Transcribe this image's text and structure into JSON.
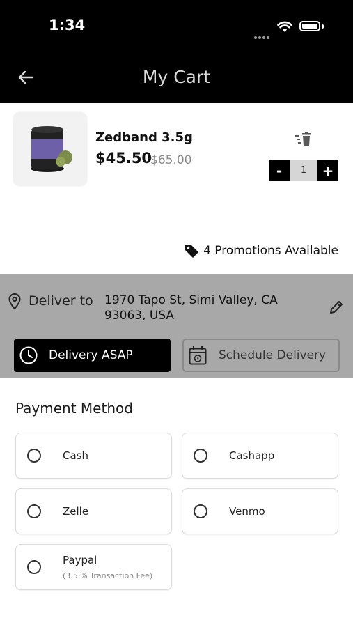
{
  "status_bar": {
    "time": "1:34"
  },
  "header": {
    "title": "My Cart"
  },
  "cart_item": {
    "name": "Zedband 3.5g",
    "price": "$45.50",
    "original_price": "$65.00",
    "quantity": "1",
    "decrement_label": "-",
    "increment_label": "+"
  },
  "promotions": {
    "label": "4 Promotions Available"
  },
  "delivery": {
    "deliver_to_label": "Deliver to",
    "address_line1": "1970 Tapo St, Simi Valley, CA",
    "address_line2": "93063, USA",
    "asap_label": "Delivery ASAP",
    "schedule_label": "Schedule Delivery"
  },
  "payment": {
    "title": "Payment Method",
    "options": [
      {
        "label": "Cash"
      },
      {
        "label": "Cashapp"
      },
      {
        "label": "Zelle"
      },
      {
        "label": "Venmo"
      },
      {
        "label": "Paypal",
        "note": "(3.5 % Transaction Fee)"
      }
    ]
  },
  "colors": {
    "header_bg": "#000000",
    "delivery_panel_bg": "#a8a8a8",
    "accent": "#000000"
  }
}
